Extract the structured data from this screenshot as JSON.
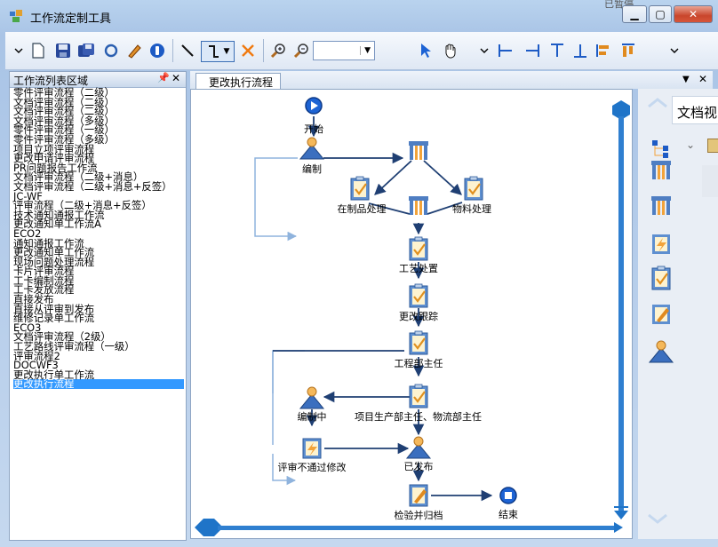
{
  "window": {
    "title": "工作流定制工具",
    "top_right_text": "已暂停"
  },
  "left_panel": {
    "title": "工作流列表区域",
    "items": [
      "零件评审流程（二级）",
      "文档评审流程（二级）",
      "文档评审流程（二级）",
      "文档评审流程（多级）",
      "零件评审流程（一级）",
      "零件评审流程（多级）",
      "项目立项评审流程",
      "更改申请评审流程",
      "PR问题报告工作流",
      "文档评审流程（二级+消息）",
      "文档评审流程（二级+消息+反签）",
      "JC-WF",
      "评审流程（二级+消息+反签）",
      "技术通知通报工作流",
      "更改通知单工作流A",
      "ECO2",
      "通知通报工作流",
      "更改通知单工作流",
      "现场问题处理流程",
      "卡片评审流程",
      "工卡编制流程",
      "工卡发放流程",
      "直接发布",
      "直接从评审到发布",
      "维修记录单工作流",
      "ECO3",
      "文档评审流程（2级）",
      "工艺路线评审流程（一级）",
      "评审流程2",
      "DOCWF3",
      "更改执行单工作流",
      "更改执行流程"
    ],
    "selected_index": 31
  },
  "document": {
    "tab_label": "更改执行流程",
    "side_panel_label": "文档视"
  },
  "diagram": {
    "nodes": {
      "start": "开始",
      "compile": "编制",
      "in_process": "在制品处理",
      "material": "物料处理",
      "process_handling": "工艺处置",
      "change_tracking": "更改跟踪",
      "engineering_head": "工程部主任",
      "project_heads": "项目生产部主任、物流部主任",
      "compiling": "编制中",
      "review_fail": "评审不通过修改",
      "released": "已发布",
      "verify_archive": "检验并归档",
      "end": "结束"
    }
  },
  "colors": {
    "arrow": "#1f3f73",
    "accent": "#1a6fd8",
    "scroll": "#1f74c8",
    "selection": "#3399ff"
  }
}
